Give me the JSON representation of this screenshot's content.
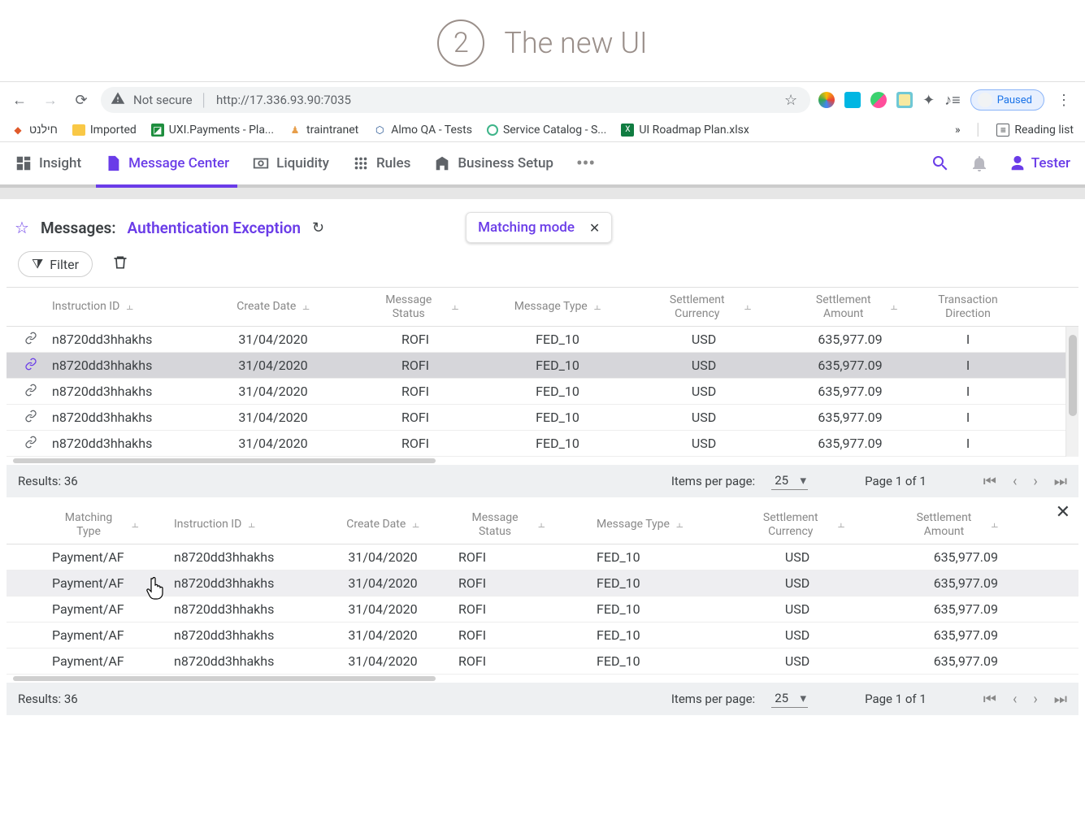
{
  "slide": {
    "number": "2",
    "title": "The new UI"
  },
  "browser": {
    "not_secure": "Not secure",
    "url": "http://17.336.93.90:7035",
    "paused": "Paused",
    "bookmarks": [
      {
        "label": "חילנט"
      },
      {
        "label": "Imported"
      },
      {
        "label": "UXI.Payments - Pla..."
      },
      {
        "label": "traintranet"
      },
      {
        "label": "Almo QA - Tests"
      },
      {
        "label": "Service Catalog - S..."
      },
      {
        "label": "UI Roadmap Plan.xlsx"
      }
    ],
    "overflow_glyph": "»",
    "reading_list": "Reading list"
  },
  "nav": {
    "tabs": [
      {
        "label": "Insight"
      },
      {
        "label": "Message Center"
      },
      {
        "label": "Liquidity"
      },
      {
        "label": "Rules"
      },
      {
        "label": "Business Setup"
      }
    ],
    "user": "Tester"
  },
  "page": {
    "messages_label": "Messages:",
    "view_name": "Authentication Exception",
    "mode_label": "Matching mode",
    "filter_label": "Filter"
  },
  "top_grid": {
    "columns": [
      "Instruction ID",
      "Create Date",
      "Message Status",
      "Message Type",
      "Settlement Currency",
      "Settlement Amount",
      "Transaction Direction"
    ],
    "rows": [
      {
        "id": "n8720dd3hhakhs",
        "date": "31/04/2020",
        "status": "ROFI",
        "type": "FED_10",
        "curr": "USD",
        "amt": "635,977.09",
        "dir": "I",
        "selected": false
      },
      {
        "id": "n8720dd3hhakhs",
        "date": "31/04/2020",
        "status": "ROFI",
        "type": "FED_10",
        "curr": "USD",
        "amt": "635,977.09",
        "dir": "I",
        "selected": true
      },
      {
        "id": "n8720dd3hhakhs",
        "date": "31/04/2020",
        "status": "ROFI",
        "type": "FED_10",
        "curr": "USD",
        "amt": "635,977.09",
        "dir": "I",
        "selected": false
      },
      {
        "id": "n8720dd3hhakhs",
        "date": "31/04/2020",
        "status": "ROFI",
        "type": "FED_10",
        "curr": "USD",
        "amt": "635,977.09",
        "dir": "I",
        "selected": false
      },
      {
        "id": "n8720dd3hhakhs",
        "date": "31/04/2020",
        "status": "ROFI",
        "type": "FED_10",
        "curr": "USD",
        "amt": "635,977.09",
        "dir": "I",
        "selected": false
      }
    ],
    "results_label": "Results:",
    "results_count": "36",
    "items_per_page_label": "Items per page:",
    "items_per_page_value": "25",
    "page_label": "Page 1 of 1"
  },
  "bottom_grid": {
    "columns": [
      "Matching Type",
      "Instruction ID",
      "Create Date",
      "Message Status",
      "Message Type",
      "Settlement Currency",
      "Settlement Amount"
    ],
    "rows": [
      {
        "mt": "Payment/AF",
        "id": "n8720dd3hhakhs",
        "date": "31/04/2020",
        "status": "ROFI",
        "type": "FED_10",
        "curr": "USD",
        "amt": "635,977.09",
        "hovered": false
      },
      {
        "mt": "Payment/AF",
        "id": "n8720dd3hhakhs",
        "date": "31/04/2020",
        "status": "ROFI",
        "type": "FED_10",
        "curr": "USD",
        "amt": "635,977.09",
        "hovered": true
      },
      {
        "mt": "Payment/AF",
        "id": "n8720dd3hhakhs",
        "date": "31/04/2020",
        "status": "ROFI",
        "type": "FED_10",
        "curr": "USD",
        "amt": "635,977.09",
        "hovered": false
      },
      {
        "mt": "Payment/AF",
        "id": "n8720dd3hhakhs",
        "date": "31/04/2020",
        "status": "ROFI",
        "type": "FED_10",
        "curr": "USD",
        "amt": "635,977.09",
        "hovered": false
      },
      {
        "mt": "Payment/AF",
        "id": "n8720dd3hhakhs",
        "date": "31/04/2020",
        "status": "ROFI",
        "type": "FED_10",
        "curr": "USD",
        "amt": "635,977.09",
        "hovered": false
      }
    ],
    "results_label": "Results:",
    "results_count": "36",
    "items_per_page_label": "Items per page:",
    "items_per_page_value": "25",
    "page_label": "Page 1 of 1"
  }
}
